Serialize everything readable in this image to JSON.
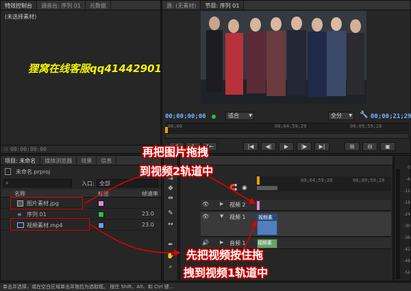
{
  "effect_controls": {
    "tabs": [
      "特效控制台",
      "调音台: 序列 01",
      "元数据"
    ],
    "empty_label": "(未选择素材)",
    "watermark": "狸窝在线客服qq41442901",
    "timecode": "00:00:00:00"
  },
  "source_monitor": {
    "tabs": [
      "源: (无素材)",
      "节目: 序列 01"
    ],
    "current_time": "00;00;00;00",
    "fit_select": "适合",
    "quality_select": "全分",
    "duration": "00;00;21;29",
    "ruler_times": [
      "00;00",
      "00;04;59;29",
      "00;09;59;28"
    ]
  },
  "project_panel": {
    "tabs": [
      "项目: 未命名",
      "媒体浏览器",
      "效果",
      "信息"
    ],
    "project_file": "未命名.prproj",
    "search_placeholder": "",
    "in_label": "入口:",
    "in_value": "全部",
    "columns": [
      "名称",
      "标签",
      "帧速率"
    ],
    "items": [
      {
        "name": "图片素材.jpg",
        "rate": "",
        "color": "#e08ad8",
        "icon": "image-icon"
      },
      {
        "name": "序列 01",
        "rate": "23.0",
        "color": "#39b54a",
        "icon": "sequence-icon"
      },
      {
        "name": "视频素材.mp4",
        "rate": "23.0",
        "color": "#6f9fd8",
        "icon": "video-file-icon"
      }
    ]
  },
  "timeline": {
    "ruler_times": [
      "00;04;59;28",
      "00;09;59;28"
    ],
    "tracks": [
      {
        "name": "视频 2",
        "clip": ""
      },
      {
        "name": "视频 1",
        "clip": "视频素"
      },
      {
        "name": "音频 1",
        "clip": "视频素"
      }
    ]
  },
  "audio_meter": {
    "ticks": [
      "0",
      "-6",
      "-12",
      "-18",
      "-24",
      "-30",
      "-36",
      "-42",
      "-48",
      "-54"
    ]
  },
  "annotations": {
    "top_line1": "再把图片拖拽",
    "top_line2": "到视频2轨道中",
    "bottom_line1": "先把视频按住拖",
    "bottom_line2": "拽到视频1轨道中"
  },
  "status_bar": {
    "text": "单击并选择，或在空白区域单击并拖拉为选取框。 按住 Shift、Alt、和 Ctrl 键..."
  },
  "colors": {
    "accent": "#6fb6ff",
    "annotation_red": "#cc0000",
    "watermark_yellow": "#f5f500",
    "playhead_orange": "#e8a000"
  }
}
